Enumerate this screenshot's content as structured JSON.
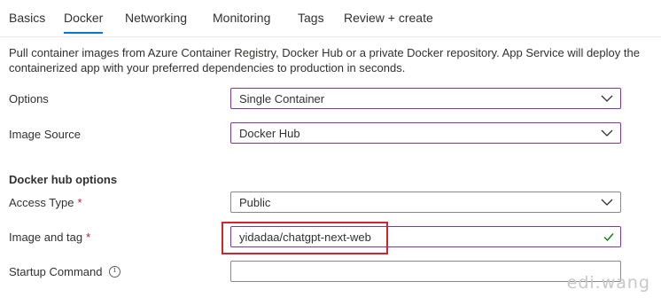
{
  "tabs": [
    {
      "label": "Basics",
      "active": false
    },
    {
      "label": "Docker",
      "active": true
    },
    {
      "label": "Networking",
      "active": false
    },
    {
      "label": "Monitoring",
      "active": false
    },
    {
      "label": "Tags",
      "active": false
    },
    {
      "label": "Review + create",
      "active": false
    }
  ],
  "description": "Pull container images from Azure Container Registry, Docker Hub or a private Docker repository. App Service will deploy the containerized app with your preferred dependencies to production in seconds.",
  "fields": {
    "options": {
      "label": "Options",
      "value": "Single Container"
    },
    "image_source": {
      "label": "Image Source",
      "value": "Docker Hub"
    }
  },
  "docker_hub": {
    "section_title": "Docker hub options",
    "access_type": {
      "label": "Access Type",
      "required": "*",
      "value": "Public"
    },
    "image_and_tag": {
      "label": "Image and tag",
      "required": "*",
      "value": "yidadaa/chatgpt-next-web"
    },
    "startup_command": {
      "label": "Startup Command",
      "info": "i",
      "value": ""
    }
  },
  "watermark": "edi.wang",
  "colors": {
    "accent": "#0078d4",
    "focus_border": "#7c3a97",
    "required": "#a4262c",
    "highlight_box": "#d3242b",
    "valid_check": "#107c10"
  }
}
